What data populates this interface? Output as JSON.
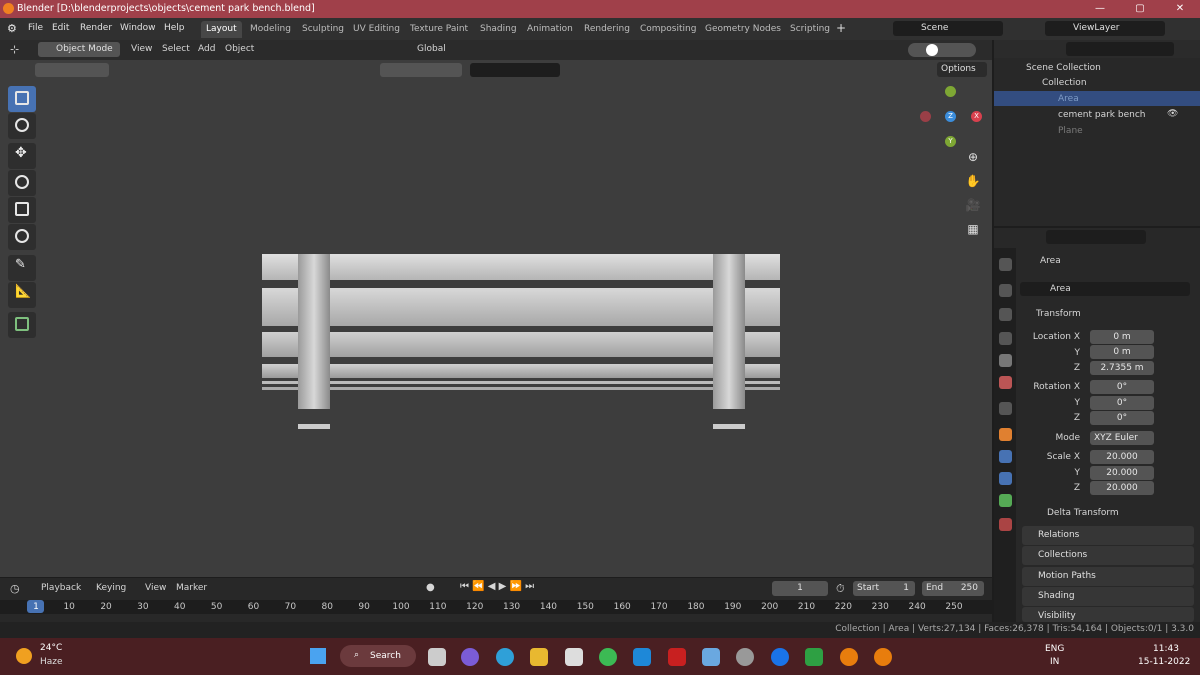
{
  "window": {
    "title": "Blender [D:\\blenderprojects\\objects\\cement park bench.blend]"
  },
  "menus": [
    "File",
    "Edit",
    "Render",
    "Window",
    "Help"
  ],
  "workspaces": [
    {
      "label": "Layout",
      "active": true
    },
    {
      "label": "Modeling"
    },
    {
      "label": "Sculpting"
    },
    {
      "label": "UV Editing"
    },
    {
      "label": "Texture Paint"
    },
    {
      "label": "Shading"
    },
    {
      "label": "Animation"
    },
    {
      "label": "Rendering"
    },
    {
      "label": "Compositing"
    },
    {
      "label": "Geometry Nodes"
    },
    {
      "label": "Scripting"
    }
  ],
  "scene": {
    "label": "Scene",
    "view_layer": "ViewLayer"
  },
  "viewport_header": {
    "mode": "Object Mode",
    "view": "View",
    "select": "Select",
    "add": "Add",
    "object": "Object",
    "orientation": "Global",
    "options": "Options"
  },
  "outliner": {
    "root": "Scene Collection",
    "collection": "Collection",
    "items": [
      {
        "name": "Area",
        "selected": true
      },
      {
        "name": "cement park bench"
      },
      {
        "name": "Plane"
      }
    ]
  },
  "properties": {
    "object_name": "Area",
    "datablock": "Area",
    "transform_label": "Transform",
    "location": {
      "label": "Location X",
      "x": "0 m",
      "y": "0 m",
      "z": "2.7355 m"
    },
    "rotation": {
      "label": "Rotation X",
      "x": "0°",
      "y": "0°",
      "z": "0°"
    },
    "mode": {
      "label": "Mode",
      "value": "XYZ Euler"
    },
    "scale": {
      "label": "Scale X",
      "x": "20.000",
      "y": "20.000",
      "z": "20.000"
    },
    "axis_y": "Y",
    "axis_z": "Z",
    "delta": "Delta Transform",
    "panels": [
      "Relations",
      "Collections",
      "Motion Paths",
      "Shading",
      "Visibility"
    ]
  },
  "timeline": {
    "playback": "Playback",
    "keying": "Keying",
    "view": "View",
    "marker": "Marker",
    "current_frame": "1",
    "start_label": "Start",
    "start": "1",
    "end_label": "End",
    "end": "250",
    "ticks": [
      "1",
      "10",
      "20",
      "30",
      "40",
      "50",
      "60",
      "70",
      "80",
      "90",
      "100",
      "110",
      "120",
      "130",
      "140",
      "150",
      "160",
      "170",
      "180",
      "190",
      "200",
      "210",
      "220",
      "230",
      "240",
      "250"
    ]
  },
  "status": {
    "text": "Collection | Area | Verts:27,134 | Faces:26,378 | Tris:54,164 | Objects:0/1 | 3.3.0"
  },
  "taskbar": {
    "weather_temp": "24°C",
    "weather_desc": "Haze",
    "search": "Search",
    "lang1": "ENG",
    "lang2": "IN",
    "time": "11:43",
    "date": "15-11-2022"
  },
  "colors": {
    "accent": "#4772b3",
    "title": "#a0404a",
    "axis_x": "#d9414e",
    "axis_y": "#7ea734",
    "axis_z": "#3b8ddb"
  }
}
